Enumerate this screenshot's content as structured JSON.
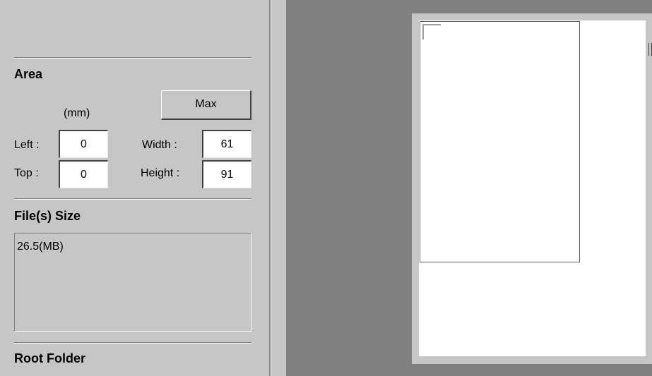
{
  "area": {
    "title": "Area",
    "unit_label": "(mm)",
    "max_button_label": "Max",
    "left_label": "Left :",
    "left_value": "0",
    "top_label": "Top :",
    "top_value": "0",
    "width_label": "Width :",
    "width_value": "61",
    "height_label": "Height :",
    "height_value": "91"
  },
  "file_size": {
    "title": "File(s) Size",
    "value": "26.5(MB)"
  },
  "root_folder": {
    "title": "Root Folder"
  }
}
